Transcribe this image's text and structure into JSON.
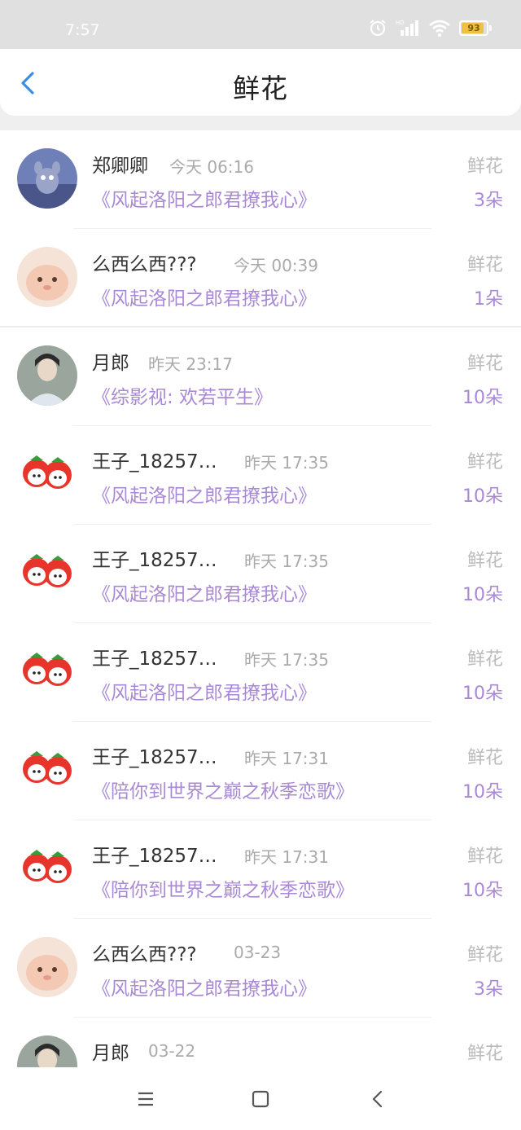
{
  "status_bar": {
    "time": "7:57",
    "battery": "93",
    "icons": [
      "alarm-icon",
      "hd-signal-icon",
      "wifi-icon",
      "battery-icon"
    ]
  },
  "header": {
    "title": "鲜花",
    "back_icon": "chevron-left-icon"
  },
  "colors": {
    "accent": "#a989d6",
    "back": "#3a8ee6",
    "muted": "#aaaaaa"
  },
  "rows": [
    {
      "name": "郑卿卿",
      "time": "今天 06:16",
      "book": "《风起洛阳之郎君撩我心》",
      "gift": "鲜花",
      "count": "3朵",
      "avatar": "cartoon"
    },
    {
      "name": "么西么西???",
      "time": "今天 00:39",
      "book": "《风起洛阳之郎君撩我心》",
      "gift": "鲜花",
      "count": "1朵",
      "avatar": "pet"
    },
    {
      "name": "月郎",
      "time": "昨天 23:17",
      "book": "《综影视: 欢若平生》",
      "gift": "鲜花",
      "count": "10朵",
      "avatar": "person"
    },
    {
      "name": "王子_18257…",
      "time": "昨天 17:35",
      "book": "《风起洛阳之郎君撩我心》",
      "gift": "鲜花",
      "count": "10朵",
      "avatar": "strawberry"
    },
    {
      "name": "王子_18257…",
      "time": "昨天 17:35",
      "book": "《风起洛阳之郎君撩我心》",
      "gift": "鲜花",
      "count": "10朵",
      "avatar": "strawberry"
    },
    {
      "name": "王子_18257…",
      "time": "昨天 17:35",
      "book": "《风起洛阳之郎君撩我心》",
      "gift": "鲜花",
      "count": "10朵",
      "avatar": "strawberry"
    },
    {
      "name": "王子_18257…",
      "time": "昨天 17:31",
      "book": "《陪你到世界之巅之秋季恋歌》",
      "gift": "鲜花",
      "count": "10朵",
      "avatar": "strawberry"
    },
    {
      "name": "王子_18257…",
      "time": "昨天 17:31",
      "book": "《陪你到世界之巅之秋季恋歌》",
      "gift": "鲜花",
      "count": "10朵",
      "avatar": "strawberry"
    },
    {
      "name": "么西么西???",
      "time": "03-23",
      "book": "《风起洛阳之郎君撩我心》",
      "gift": "鲜花",
      "count": "3朵",
      "avatar": "pet"
    },
    {
      "name": "月郎",
      "time": "03-22",
      "book": "",
      "gift": "鲜花",
      "count": "",
      "avatar": "person"
    }
  ],
  "nav_bar": {
    "items": [
      "menu-icon",
      "home-square-icon",
      "back-triangle-icon"
    ]
  }
}
